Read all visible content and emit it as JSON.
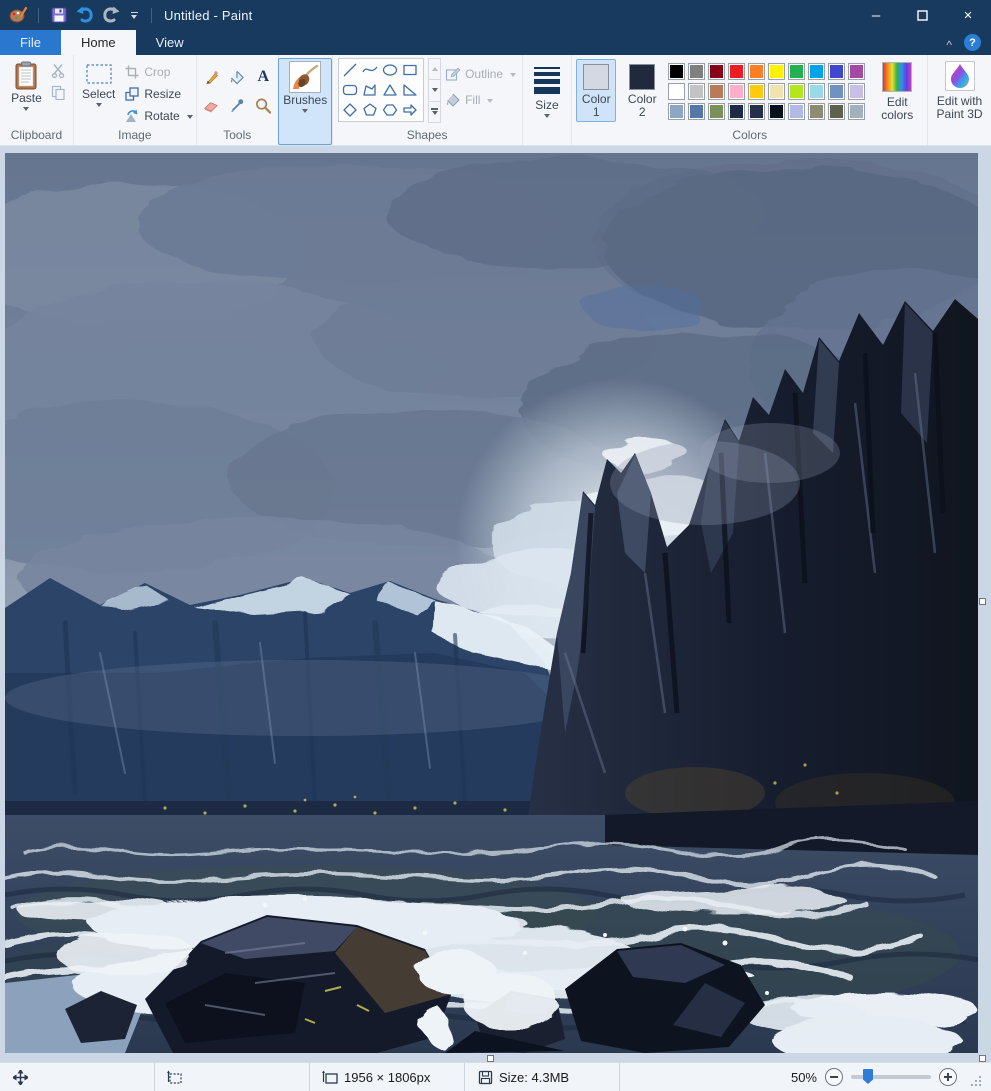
{
  "window": {
    "title": "Untitled - Paint"
  },
  "titlebar": {
    "minimize_glyph": "–",
    "maximize_glyph": "❒",
    "close_glyph": "×"
  },
  "tabs": {
    "file": "File",
    "home": "Home",
    "view": "View",
    "active_tab": "Home",
    "help_glyph": "?",
    "collapse_ribbon_glyph": "^"
  },
  "ribbon": {
    "clipboard": {
      "group_label": "Clipboard",
      "paste_label": "Paste"
    },
    "image": {
      "group_label": "Image",
      "select_label": "Select",
      "crop_label": "Crop",
      "resize_label": "Resize",
      "rotate_label": "Rotate"
    },
    "tools": {
      "group_label": "Tools",
      "items": [
        "pencil",
        "fill-with-color",
        "text",
        "eraser",
        "color-picker",
        "magnifier"
      ]
    },
    "brushes": {
      "label": "Brushes",
      "selected": true
    },
    "shapes": {
      "group_label": "Shapes",
      "outline_label": "Outline",
      "fill_label": "Fill",
      "items": [
        "line",
        "curve",
        "oval",
        "rectangle",
        "rounded-rectangle",
        "polygon",
        "triangle",
        "right-triangle",
        "diamond",
        "pentagon",
        "hexagon",
        "right-arrow"
      ]
    },
    "size": {
      "label": "Size"
    },
    "colors": {
      "group_label": "Colors",
      "color1_label": "Color 1",
      "color2_label": "Color 2",
      "color1_value": "#d3d8e2",
      "color2_value": "#202a3c",
      "edit_colors_label": "Edit colors",
      "palette": [
        "#000000",
        "#7f7f7f",
        "#880015",
        "#ed1c24",
        "#ff7f27",
        "#fff200",
        "#22b14c",
        "#00a2e8",
        "#3f48cc",
        "#a349a4",
        "#ffffff",
        "#c3c3c3",
        "#b97a57",
        "#ffaec9",
        "#ffc90e",
        "#efe4b0",
        "#b5e61d",
        "#99d9ea",
        "#7092be",
        "#c8bfe7",
        "#8da6c6",
        "#5578a8",
        "#7b9159",
        "#1e2b46",
        "#24304b",
        "#0a101c",
        "#b3b9e6",
        "#8d8c71",
        "#60604f",
        "#a3b1bf"
      ]
    },
    "paint3d": {
      "label": "Edit with Paint 3D"
    }
  },
  "canvas": {
    "description": "Digital painting of a stormy northern seascape: towering dark sea cliffs on the right, snow-capped blue mountains on the horizon, a bright break in heavy gray clouds, rough gray-green waves with white foam, and dark wet rocks with crashing surf in the foreground."
  },
  "status_bar": {
    "image_dimensions": "1956 × 1806px",
    "file_size_label": "Size: 4.3MB",
    "zoom_value": "50%"
  }
}
